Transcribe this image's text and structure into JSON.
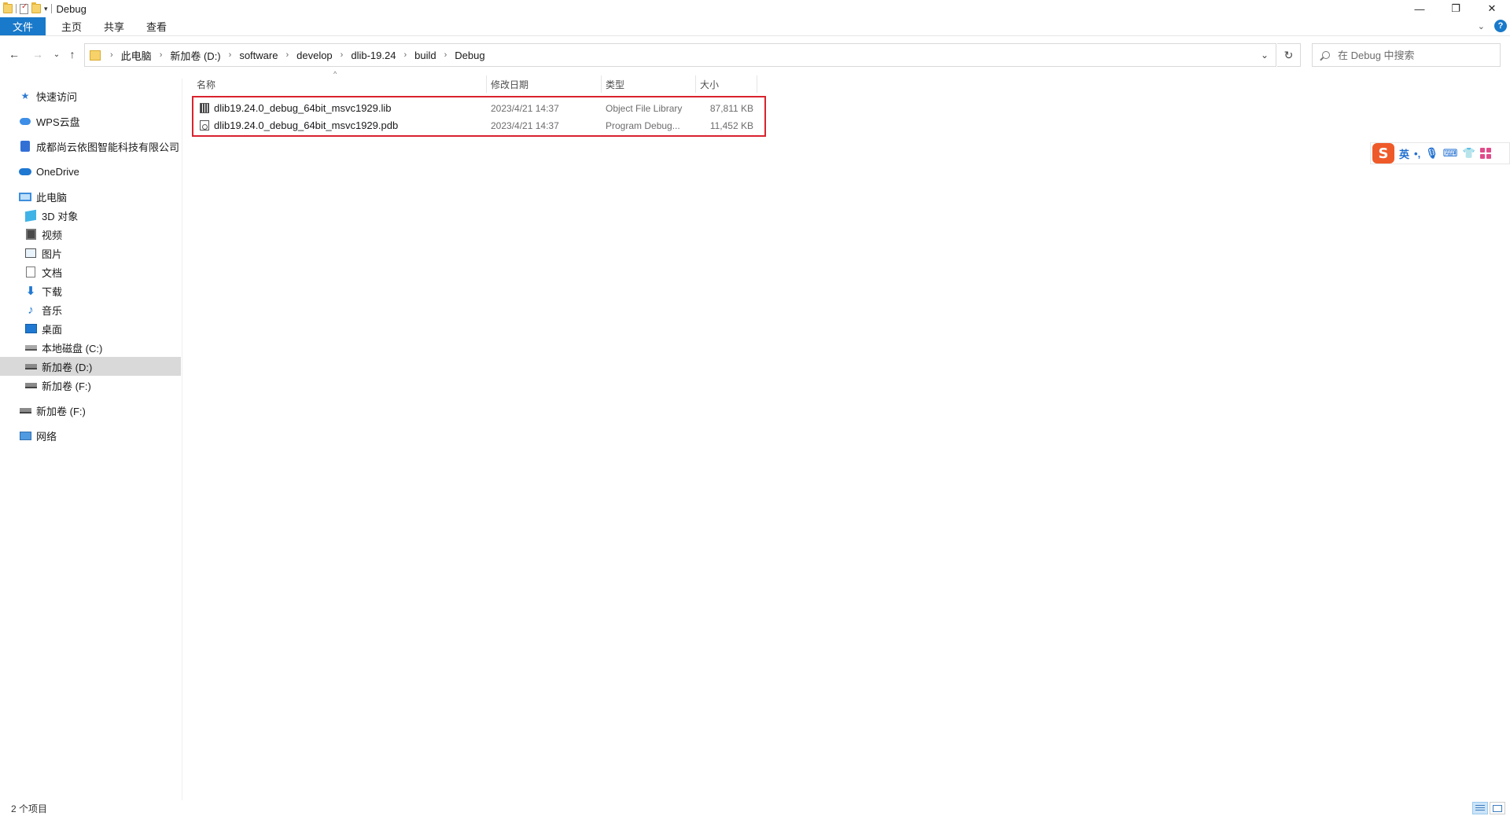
{
  "window": {
    "title": "Debug",
    "controls": {
      "minimize": "—",
      "restore": "❐",
      "close": "✕"
    }
  },
  "ribbon": {
    "tabs": [
      "文件",
      "主页",
      "共享",
      "查看"
    ],
    "help": "?"
  },
  "address": {
    "crumbs": [
      "此电脑",
      "新加卷 (D:)",
      "software",
      "develop",
      "dlib-19.24",
      "build",
      "Debug"
    ],
    "search_placeholder": "在 Debug 中搜索"
  },
  "sidebar": {
    "items": [
      {
        "label": "快速访问",
        "icon": "star-icon"
      },
      {
        "label": "WPS云盘",
        "icon": "cloud-icon"
      },
      {
        "label": "成都尚云依图智能科技有限公司",
        "icon": "org-icon"
      },
      {
        "label": "OneDrive",
        "icon": "onedrive-icon"
      },
      {
        "label": "此电脑",
        "icon": "pc-icon"
      },
      {
        "label": "3D 对象",
        "icon": "3d-objects-icon"
      },
      {
        "label": "视频",
        "icon": "video-icon"
      },
      {
        "label": "图片",
        "icon": "pictures-icon"
      },
      {
        "label": "文档",
        "icon": "documents-icon"
      },
      {
        "label": "下载",
        "icon": "download-icon"
      },
      {
        "label": "音乐",
        "icon": "music-icon"
      },
      {
        "label": "桌面",
        "icon": "desktop-icon"
      },
      {
        "label": "本地磁盘 (C:)",
        "icon": "drive-icon"
      },
      {
        "label": "新加卷 (D:)",
        "icon": "drive-icon",
        "selected": true
      },
      {
        "label": "新加卷 (F:)",
        "icon": "drive-icon"
      },
      {
        "label": "新加卷 (F:)",
        "icon": "drive-icon"
      },
      {
        "label": "网络",
        "icon": "network-icon"
      }
    ]
  },
  "columns": {
    "name": "名称",
    "modified": "修改日期",
    "type": "类型",
    "size": "大小"
  },
  "files": [
    {
      "name": "dlib19.24.0_debug_64bit_msvc1929.lib",
      "modified": "2023/4/21 14:37",
      "type": "Object File Library",
      "size": "87,811 KB",
      "icon": "lib-file-icon"
    },
    {
      "name": "dlib19.24.0_debug_64bit_msvc1929.pdb",
      "modified": "2023/4/21 14:37",
      "type": "Program Debug...",
      "size": "11,452 KB",
      "icon": "pdb-file-icon"
    }
  ],
  "ime": {
    "logo": "S",
    "lang": "英",
    "punct": "•,"
  },
  "status": {
    "count": "2 个项目"
  },
  "colors": {
    "accent": "#1979ca",
    "highlight_border": "#d9232e",
    "selected_bg": "#d9d9d9"
  }
}
